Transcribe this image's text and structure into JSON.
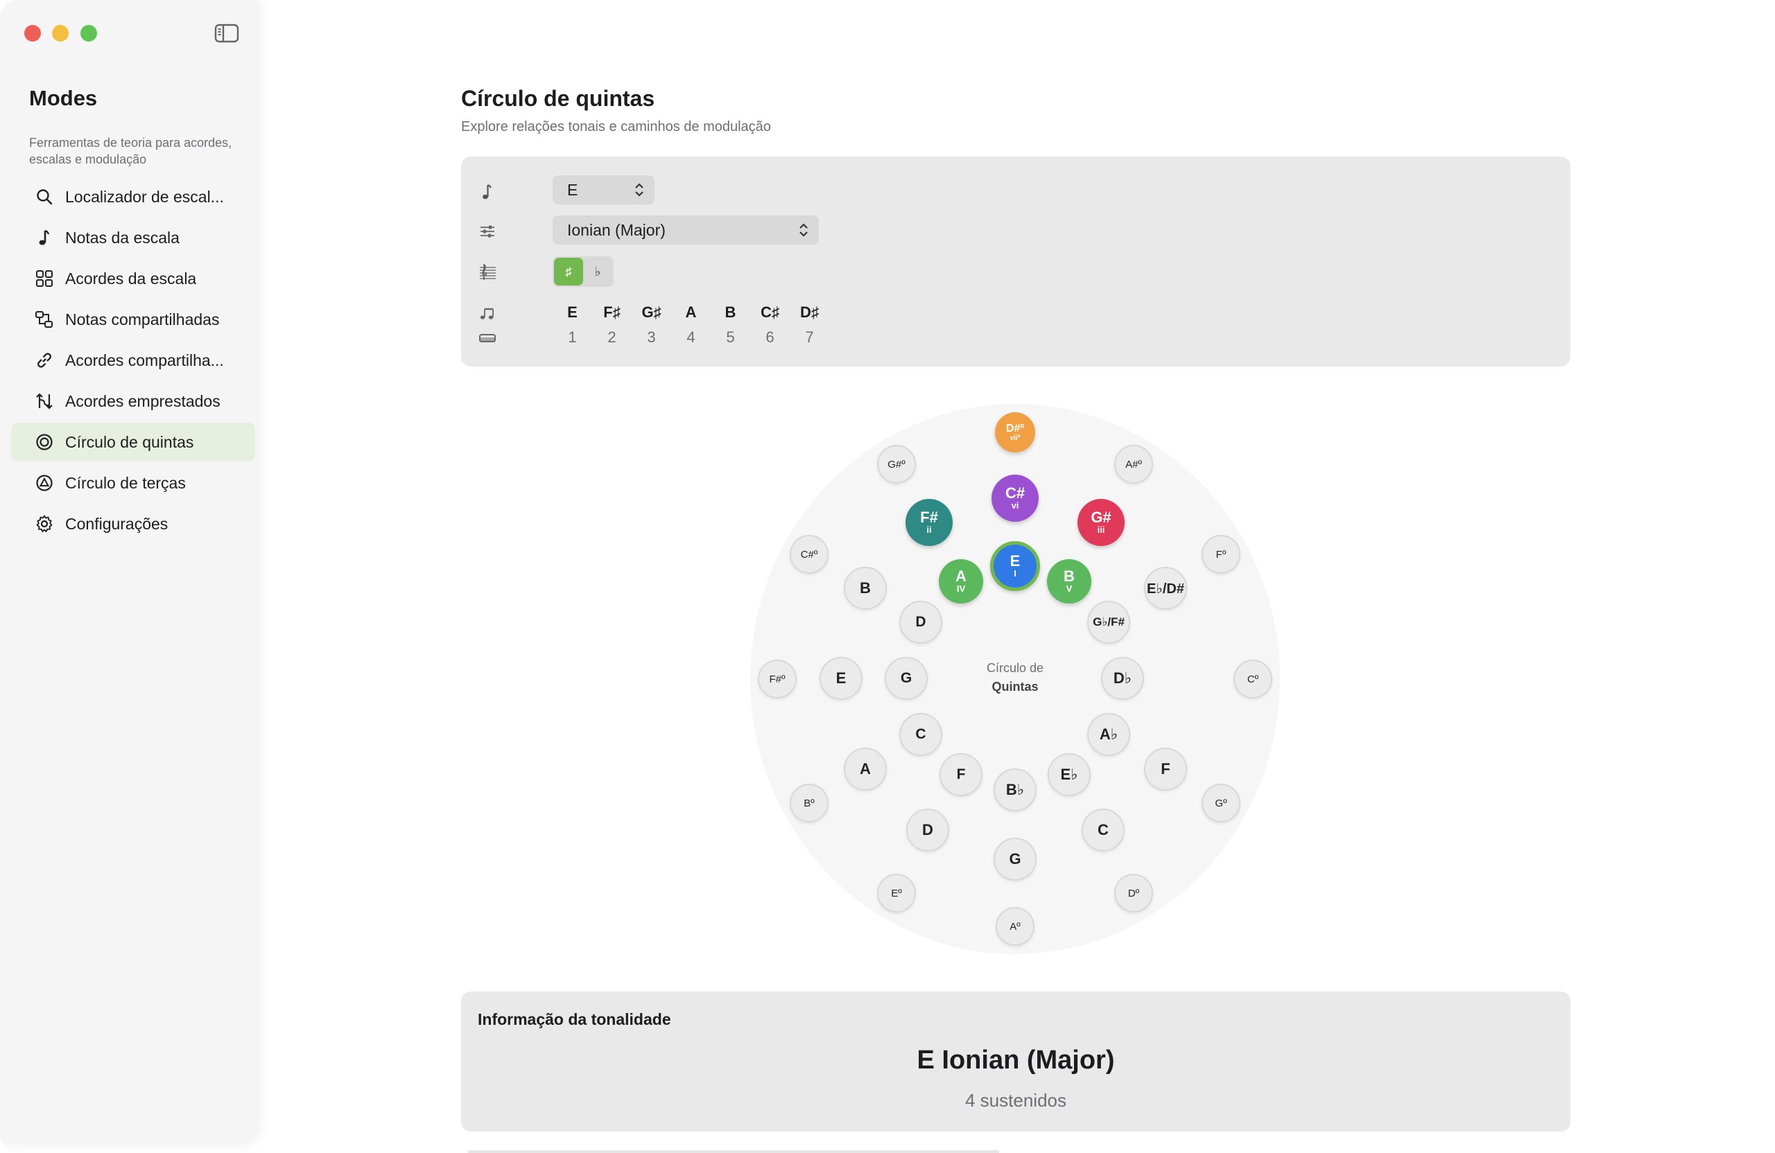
{
  "sidebar": {
    "title": "Modes",
    "description": "Ferramentas de teoria para acordes, escalas e modulação",
    "items": [
      {
        "label": "Localizador de escal...",
        "icon": "search-icon",
        "active": false
      },
      {
        "label": "Notas da escala",
        "icon": "music-note-icon",
        "active": false
      },
      {
        "label": "Acordes da escala",
        "icon": "grid-icon",
        "active": false
      },
      {
        "label": "Notas compartilhadas",
        "icon": "shared-notes-icon",
        "active": false
      },
      {
        "label": "Acordes compartilha...",
        "icon": "link-icon",
        "active": false
      },
      {
        "label": "Acordes emprestados",
        "icon": "borrowed-chords-icon",
        "active": false
      },
      {
        "label": "Círculo de quintas",
        "icon": "circle-icon",
        "active": true
      },
      {
        "label": "Círculo de terças",
        "icon": "triangle-circle-icon",
        "active": false
      },
      {
        "label": "Configurações",
        "icon": "gear-icon",
        "active": false
      }
    ]
  },
  "main": {
    "title": "Círculo de quintas",
    "subtitle": "Explore relações tonais e caminhos de modulação"
  },
  "controls": {
    "key_value": "E",
    "mode_value": "Ionian (Major)",
    "accidental_options": [
      "♯",
      "♭"
    ],
    "accidental_selected": "♯",
    "notes": [
      "E",
      "F♯",
      "G♯",
      "A",
      "B",
      "C♯",
      "D♯"
    ],
    "degrees": [
      "1",
      "2",
      "3",
      "4",
      "5",
      "6",
      "7"
    ]
  },
  "circle": {
    "center_line1": "Círculo de",
    "center_line2": "Quintas",
    "colored": [
      {
        "name": "D#º",
        "degree": "viiº",
        "color": "#f0a043"
      },
      {
        "name": "C#",
        "degree": "vi",
        "color": "#9b4fd1"
      },
      {
        "name": "F#",
        "degree": "ii",
        "color": "#2e8a84"
      },
      {
        "name": "G#",
        "degree": "iii",
        "color": "#e0395a"
      },
      {
        "name": "A",
        "degree": "IV",
        "color": "#5cb85c"
      },
      {
        "name": "E",
        "degree": "I",
        "color": "#2f7ae5"
      },
      {
        "name": "B",
        "degree": "V",
        "color": "#5cb85c"
      }
    ],
    "major": [
      "B",
      "E♭/D#",
      "G♭/F#",
      "D♭",
      "A♭",
      "E♭",
      "B♭",
      "F",
      "C",
      "G",
      "D",
      "A",
      "E"
    ],
    "minor": [
      "D",
      "G",
      "C",
      "F",
      "B♭",
      "E♭",
      "A♭",
      "D♭",
      "B♭",
      "G♭/F#"
    ],
    "dim": [
      "G#º",
      "A#º",
      "C#º",
      "Fº",
      "F#º",
      "Cº",
      "Bº",
      "Gº",
      "Eº",
      "Dº",
      "Aº"
    ]
  },
  "info": {
    "title": "Informação da tonalidade",
    "key": "E Ionian (Major)",
    "accidentals": "4 sustenidos"
  }
}
